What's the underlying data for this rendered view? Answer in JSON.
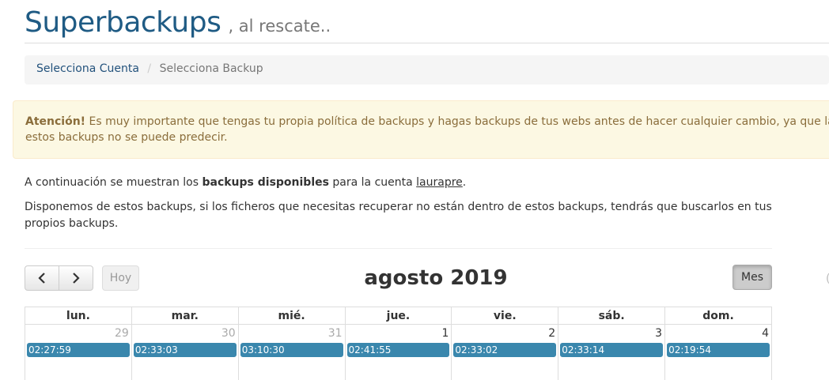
{
  "header": {
    "title": "Superbackups",
    "tagline": ", al rescate.."
  },
  "breadcrumb": {
    "items": [
      "Selecciona Cuenta",
      "Selecciona Backup"
    ],
    "separator": "/"
  },
  "alert": {
    "strong": "Atención!",
    "line1": " Es muy importante que tengas tu propia política de backups y hagas backups de tus webs antes de hacer cualquier cambio, ya que la fe",
    "line2": "estos backups no se puede predecir."
  },
  "intro": {
    "p1_prefix": "A continuación se muestran los ",
    "p1_bold": "backups disponibles",
    "p1_mid": " para la cuenta ",
    "p1_account": "laurapre",
    "p1_suffix": ".",
    "p2": "Disponemos de estos backups, si los ficheros que necesitas recuperar no están dentro de estos backups, tendrás que buscarlos en tus propios backups."
  },
  "calendar": {
    "title": "agosto 2019",
    "today_label": "Hoy",
    "view_label": "Mes",
    "prev_icon": "chevron-left-icon",
    "next_icon": "chevron-right-icon",
    "weekdays": [
      "lun.",
      "mar.",
      "mié.",
      "jue.",
      "vie.",
      "sáb.",
      "dom."
    ],
    "days": [
      {
        "num": "29",
        "other": true,
        "event": "02:27:59"
      },
      {
        "num": "30",
        "other": true,
        "event": "02:33:03"
      },
      {
        "num": "31",
        "other": true,
        "event": "03:10:30"
      },
      {
        "num": "1",
        "other": false,
        "event": "02:41:55"
      },
      {
        "num": "2",
        "other": false,
        "event": "02:33:02"
      },
      {
        "num": "3",
        "other": false,
        "event": "02:33:14"
      },
      {
        "num": "4",
        "other": false,
        "event": "02:19:54"
      }
    ]
  },
  "colors": {
    "brand": "#1f5b84",
    "event": "#3a87ad",
    "alert_bg": "#fcf8e3",
    "alert_text": "#8a6d3b"
  }
}
